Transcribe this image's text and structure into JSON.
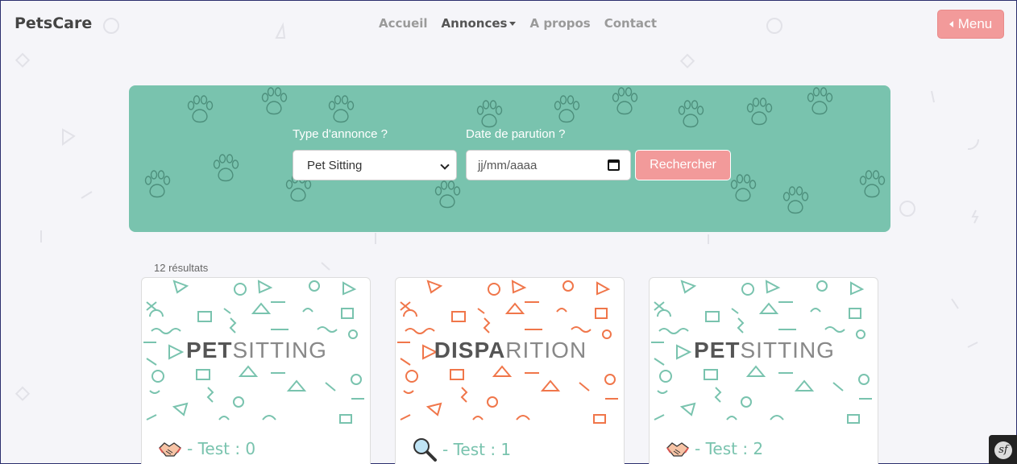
{
  "navbar": {
    "brand": "PetsCare",
    "links": [
      "Accueil",
      "Annonces",
      "A propos",
      "Contact"
    ],
    "menu_label": "Menu"
  },
  "search": {
    "type_label": "Type d'annonce ?",
    "type_value": "Pet Sitting",
    "date_label": "Date de parution ?",
    "date_placeholder": "jj/mm/aaaa",
    "submit_label": "Rechercher"
  },
  "results": {
    "count_text": "12 résultats"
  },
  "cards": [
    {
      "art_bold": "PET",
      "art_light": "SITTING",
      "title": "- Test : 0",
      "icon": "handshake-icon",
      "accent": "#79c3ae"
    },
    {
      "art_bold": "DISPA",
      "art_light": "RITION",
      "title": "- Test : 1",
      "icon": "magnifier-icon",
      "accent": "#f0764a"
    },
    {
      "art_bold": "PET",
      "art_light": "SITTING",
      "title": "- Test : 2",
      "icon": "handshake-icon",
      "accent": "#79c3ae"
    }
  ],
  "colors": {
    "primary": "#79c3ae",
    "button": "#f29a9a",
    "alert": "#f0764a"
  }
}
